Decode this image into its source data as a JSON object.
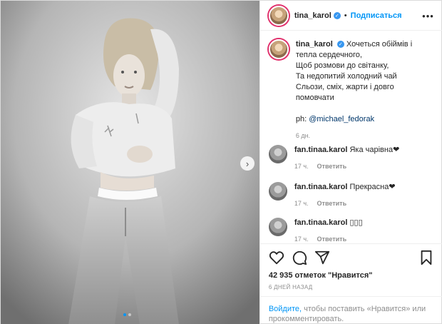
{
  "post": {
    "username": "tina_karol",
    "follow_label": "Подписаться",
    "separator": "•",
    "more_label": "•••",
    "caption_lines": [
      "Хочеться обіймів і",
      "тепла сердечного,",
      "Щоб розмови до світанку,",
      "Та недопитий холодний чай",
      "Сльози, сміх, жарти  і довго",
      "помовчати"
    ],
    "credit_prefix": "ph: ",
    "credit_mention": "@michael_fedorak",
    "caption_time": "6 дн.",
    "comments": [
      {
        "user": "fan.tinaa.karol",
        "text": "Яка чарівна❤",
        "time": "17 ч.",
        "reply": "Ответить"
      },
      {
        "user": "fan.tinaa.karol",
        "text": "Прекрасна❤",
        "time": "17 ч.",
        "reply": "Ответить"
      },
      {
        "user": "fan.tinaa.karol",
        "text": "▯▯▯",
        "time": "17 ч.",
        "reply": "Ответить"
      }
    ],
    "likes_text": "42 935 отметок \"Нравится\"",
    "date_text": "6 ДНЕЙ НАЗАД",
    "login_link": "Войдите,",
    "login_rest": " чтобы поставить «Нравится» или прокомментировать.",
    "next_glyph": "›"
  },
  "icons": [
    "heart-icon",
    "comment-icon",
    "share-icon",
    "bookmark-icon",
    "verified-icon",
    "chevron-right-icon"
  ],
  "colors": {
    "accent": "#0095f6",
    "muted": "#8e8e8e",
    "text": "#262626"
  }
}
